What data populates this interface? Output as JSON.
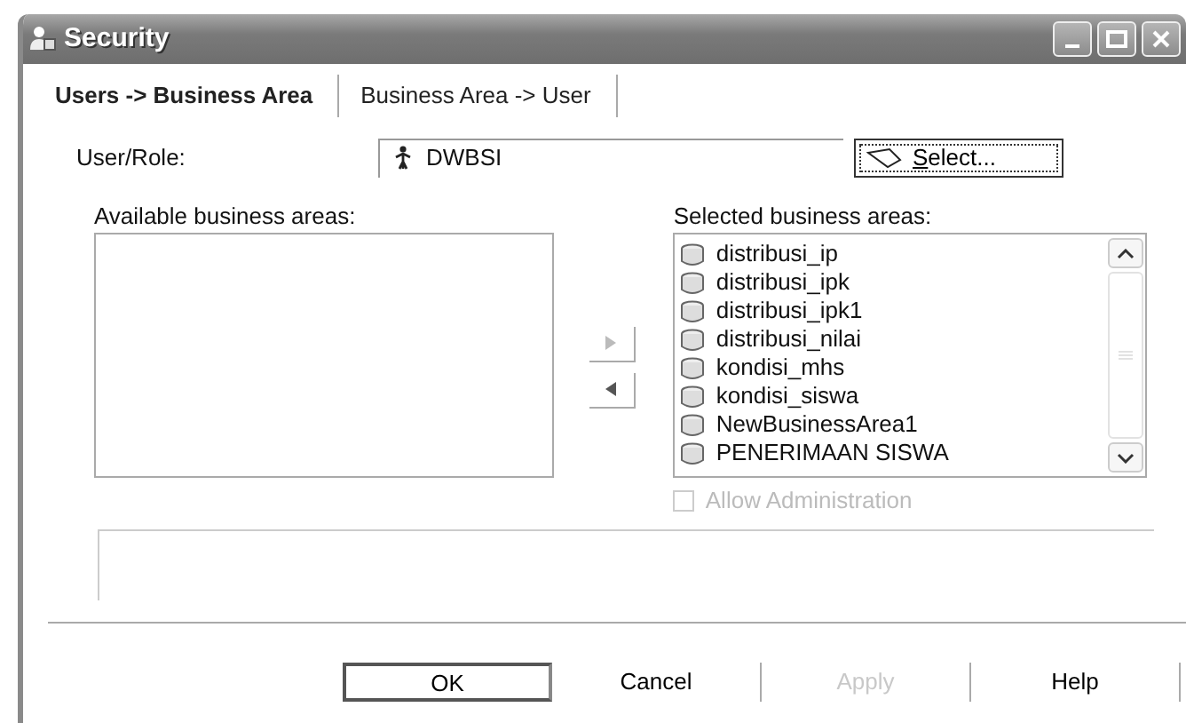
{
  "window": {
    "title": "Security"
  },
  "tabs": [
    {
      "label": "Users -> Business Area",
      "selected": true
    },
    {
      "label": "Business Area -> User",
      "selected": false
    }
  ],
  "user_role": {
    "label": "User/Role:",
    "value": "DWBSI",
    "button": "Select..."
  },
  "available_areas": {
    "label": "Available business areas:"
  },
  "selected_areas": {
    "label": "Selected business areas:",
    "items": [
      "distribusi_ip",
      "distribusi_ipk",
      "distribusi_ipk1",
      "distribusi_nilai",
      "kondisi_mhs",
      "kondisi_siswa",
      "NewBusinessArea1",
      "PENERIMAAN SISWA"
    ]
  },
  "allow_administration": {
    "label": "Allow Administration",
    "checked": false,
    "disabled": true
  },
  "buttons": [
    {
      "label": "OK",
      "default": true,
      "disabled": false
    },
    {
      "label": "Cancel",
      "default": false,
      "disabled": false
    },
    {
      "label": "Apply",
      "default": false,
      "disabled": true
    },
    {
      "label": "Help",
      "default": false,
      "disabled": false
    }
  ]
}
